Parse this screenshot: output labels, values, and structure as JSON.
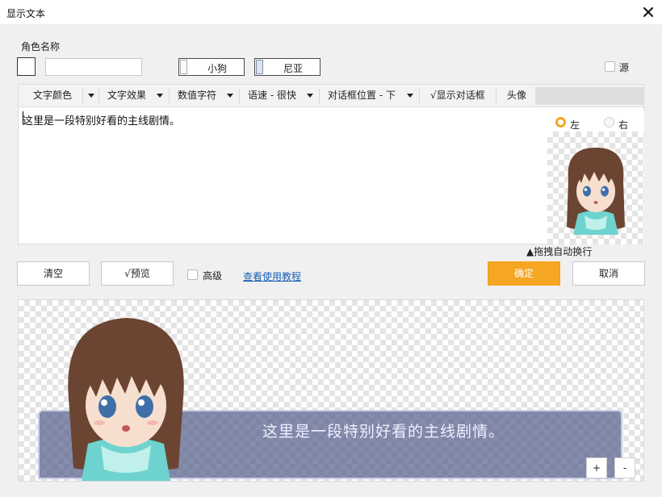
{
  "window": {
    "title": "显示文本"
  },
  "role": {
    "label": "角色名称",
    "name_value": "",
    "characters": [
      {
        "label": "小狗",
        "active": false
      },
      {
        "label": "尼亚",
        "active": true
      }
    ],
    "source_label": "源"
  },
  "toolbar": {
    "items": [
      {
        "label": "文字颜色",
        "dropdown": true
      },
      {
        "label": "文字效果",
        "dropdown": true
      },
      {
        "label": "数值字符",
        "dropdown": true
      },
      {
        "label": "语速 - 很快",
        "dropdown": true
      },
      {
        "label": "对话框位置 - 下",
        "dropdown": true
      },
      {
        "label": "√显示对话框",
        "dropdown": false
      },
      {
        "label": "头像",
        "dropdown": false
      }
    ]
  },
  "editor": {
    "text": "这里是一段特别好看的主线剧情。"
  },
  "avatar": {
    "left_label": "左",
    "right_label": "右",
    "selected": "left",
    "drag_hint": "▲拖拽自动换行"
  },
  "actions": {
    "clear_label": "清空",
    "preview_label": "√预览",
    "advanced_label": "高级",
    "tutorial_link": "查看使用教程",
    "confirm_label": "确定",
    "cancel_label": "取消"
  },
  "preview": {
    "dialog_text": "这里是一段特别好看的主线剧情。",
    "zoom_in_label": "+",
    "zoom_out_label": "-"
  },
  "colors": {
    "accent": "#f5a623",
    "link": "#1a5fb4",
    "dialog_box": "#58608c"
  }
}
